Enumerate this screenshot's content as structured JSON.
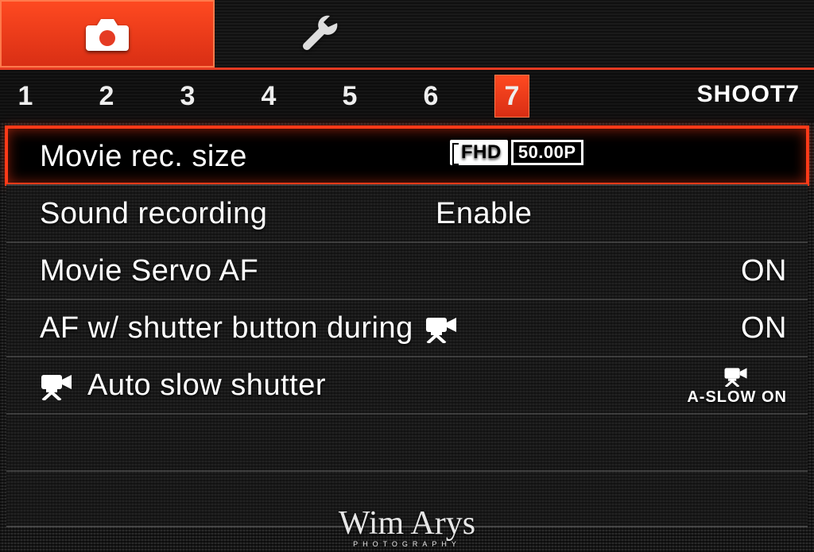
{
  "top_tabs": {
    "camera_active": true
  },
  "sub_tabs": {
    "items": [
      "1",
      "2",
      "3",
      "4",
      "5",
      "6",
      "7"
    ],
    "active_index": 6,
    "page_label": "SHOOT7"
  },
  "menu": {
    "rows": [
      {
        "label": "Movie rec. size",
        "value_type": "fhd",
        "fhd": "FHD",
        "fps": "50.00P",
        "selected": true
      },
      {
        "label": "Sound recording",
        "value": "Enable",
        "value_pos": "mid"
      },
      {
        "label": "Movie Servo AF",
        "value": "ON"
      },
      {
        "label": "AF w/ shutter button during",
        "trailing_icon": "movie-camera",
        "value": "ON"
      },
      {
        "leading_icon": "movie-camera",
        "label": "Auto slow shutter",
        "value_type": "aslow",
        "aslow_text": "A-SLOW ON"
      }
    ]
  },
  "watermark": {
    "name": "Wim Arys",
    "sub": "PHOTOGRAPHY"
  }
}
